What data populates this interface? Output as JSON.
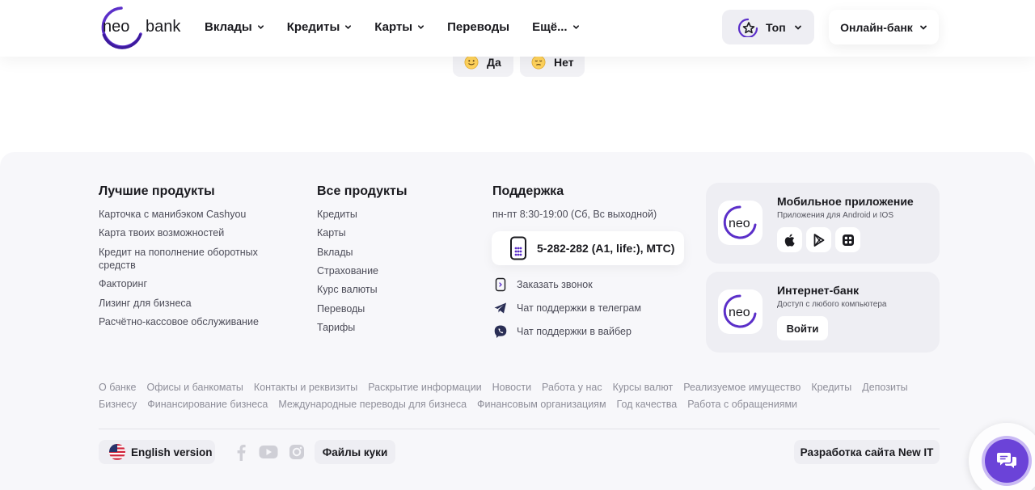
{
  "header": {
    "logo_left": "neo",
    "logo_right": "bank",
    "nav": [
      {
        "label": "Вклады",
        "dropdown": true
      },
      {
        "label": "Кредиты",
        "dropdown": true
      },
      {
        "label": "Карты",
        "dropdown": true
      },
      {
        "label": "Переводы",
        "dropdown": false
      },
      {
        "label": "Ещё...",
        "dropdown": true
      }
    ],
    "top_label": "Топ",
    "online_bank_label": "Онлайн-банк"
  },
  "feedback": {
    "yes_label": "Да",
    "no_label": "Нет"
  },
  "footer": {
    "best_products": {
      "title": "Лучшие продукты",
      "items": [
        "Карточка с манибэком Cashyou",
        "Карта твоих возможностей",
        "Кредит на пополнение оборотных",
        "средств",
        "Факторинг",
        "Лизинг для бизнеса",
        "Расчётно-кассовое обслуживание"
      ]
    },
    "all_products": {
      "title": "Все продукты",
      "items": [
        "Кредиты",
        "Карты",
        "Вклады",
        "Страхование",
        "Курс валюты",
        "Переводы",
        "Тарифы"
      ]
    },
    "support": {
      "title": "Поддержка",
      "hours": "пн-пт 8:30-19:00 (Сб, Вс выходной)",
      "phone": "5-282-282 (A1, life:), МТС)",
      "callback": "Заказать звонок",
      "telegram": "Чат поддержки в телеграм",
      "viber": "Чат поддержки в вайбер"
    },
    "mobile_app": {
      "title": "Мобильное приложение",
      "subtitle": "Приложения для Android и IOS",
      "logo_text": "neo",
      "stores": [
        "apple-icon",
        "google-play-icon",
        "app-gallery-icon"
      ]
    },
    "internet_bank": {
      "title": "Интернет-банк",
      "subtitle": "Доступ с любого компьютера",
      "logo_text": "neo",
      "login_label": "Войти"
    },
    "links_row1": [
      "О банке",
      "Офисы и банкоматы",
      "Контакты и реквизиты",
      "Раскрытие информации",
      "Новости",
      "Работа у нас",
      "Курсы валют",
      "Реализуемое имущество",
      "Кредиты",
      "Депозиты"
    ],
    "links_row2": [
      "Бизнесу",
      "Финансирование бизнеса",
      "Международные переводы для бизнеса",
      "Финансовым организациям",
      "Год качества",
      "Работа с обращениями"
    ],
    "english_label": "English version",
    "cookies_label": "Файлы куки",
    "developer_label": "Разработка сайта New IT",
    "socials": [
      "facebook-icon",
      "youtube-icon",
      "instagram-icon"
    ]
  },
  "colors": {
    "brand": "#5b2fc9",
    "chat": "#6b43d8"
  }
}
